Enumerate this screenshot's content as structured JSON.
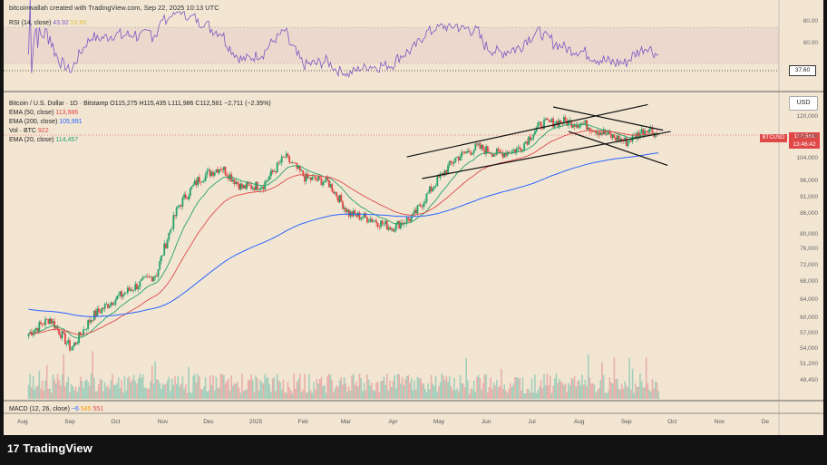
{
  "header": {
    "credit": "bitcoinwallah created with TradingView.com, Sep 22, 2025 10:13 UTC"
  },
  "rsi_legend": {
    "label": "RSI (14, close)",
    "value": "43.92",
    "ma": "53.80"
  },
  "rsi_last_tag": "37.60",
  "price_legend": {
    "title": "Bitcoin / U.S. Dollar · 1D · Bitstamp",
    "ohlc": "O115,275  H115,435  L111,986  C112,581  −2,711 (−2.35%)",
    "ema50_label": "EMA (50, close)",
    "ema50_value": "113,986",
    "ema200_label": "EMA (200, close)",
    "ema200_value": "105,991",
    "vol_label": "Vol · BTC",
    "vol_value": "922",
    "ema20_label": "EMA (20, close)",
    "ema20_value": "114,457"
  },
  "macd_legend": {
    "label": "MACD (12, 26, close)",
    "v1": "−6",
    "v2": "545",
    "v3": "551"
  },
  "currency_button": "USD",
  "symbol_tag": "BTCUSD",
  "last_price_tag": {
    "price": "112,581",
    "countdown": "13:46:42"
  },
  "brand": {
    "name": "TradingView",
    "mark": "17"
  },
  "colors": {
    "background": "#f2e6d3",
    "up": "#26a269",
    "down": "#e04848",
    "ema20": "#26a269",
    "ema50": "#e04848",
    "ema200": "#2962ff",
    "rsi": "#7e57c2",
    "rsi_ma": "#e5c04a"
  },
  "chart_data": {
    "type": "candlestick",
    "x_ticks": [
      "Aug",
      "Sep",
      "Oct",
      "Nov",
      "Dec",
      "2025",
      "Feb",
      "Mar",
      "Apr",
      "May",
      "Jun",
      "Jul",
      "Aug",
      "Sep",
      "Oct",
      "Nov",
      "De"
    ],
    "price_axis_ticks": [
      120000,
      112000,
      104000,
      96000,
      91000,
      86000,
      80000,
      76000,
      72000,
      68000,
      64000,
      60000,
      57000,
      54000,
      51200,
      48450
    ],
    "rsi_axis_ticks": [
      80,
      60
    ],
    "log_scale": true,
    "weekly_close_approx": [
      [
        "2024-08-05",
        57000
      ],
      [
        "2024-08-19",
        60000
      ],
      [
        "2024-09-02",
        54000
      ],
      [
        "2024-09-16",
        60500
      ],
      [
        "2024-09-30",
        64000
      ],
      [
        "2024-10-14",
        67000
      ],
      [
        "2024-10-28",
        70000
      ],
      [
        "2024-11-11",
        88000
      ],
      [
        "2024-11-25",
        97000
      ],
      [
        "2024-12-09",
        101000
      ],
      [
        "2024-12-23",
        94000
      ],
      [
        "2025-01-06",
        95000
      ],
      [
        "2025-01-20",
        104500
      ],
      [
        "2025-02-03",
        97000
      ],
      [
        "2025-02-17",
        96000
      ],
      [
        "2025-03-03",
        86000
      ],
      [
        "2025-03-17",
        84500
      ],
      [
        "2025-03-31",
        82000
      ],
      [
        "2025-04-14",
        85000
      ],
      [
        "2025-04-28",
        95000
      ],
      [
        "2025-05-12",
        104000
      ],
      [
        "2025-05-26",
        108000
      ],
      [
        "2025-06-09",
        105500
      ],
      [
        "2025-06-23",
        107500
      ],
      [
        "2025-07-07",
        117000
      ],
      [
        "2025-07-21",
        118000
      ],
      [
        "2025-08-04",
        117000
      ],
      [
        "2025-08-18",
        113000
      ],
      [
        "2025-09-01",
        110000
      ],
      [
        "2025-09-15",
        115500
      ],
      [
        "2025-09-22",
        112581
      ]
    ],
    "last_ohlc": {
      "open": 115275,
      "high": 115435,
      "low": 111986,
      "close": 112581
    }
  }
}
